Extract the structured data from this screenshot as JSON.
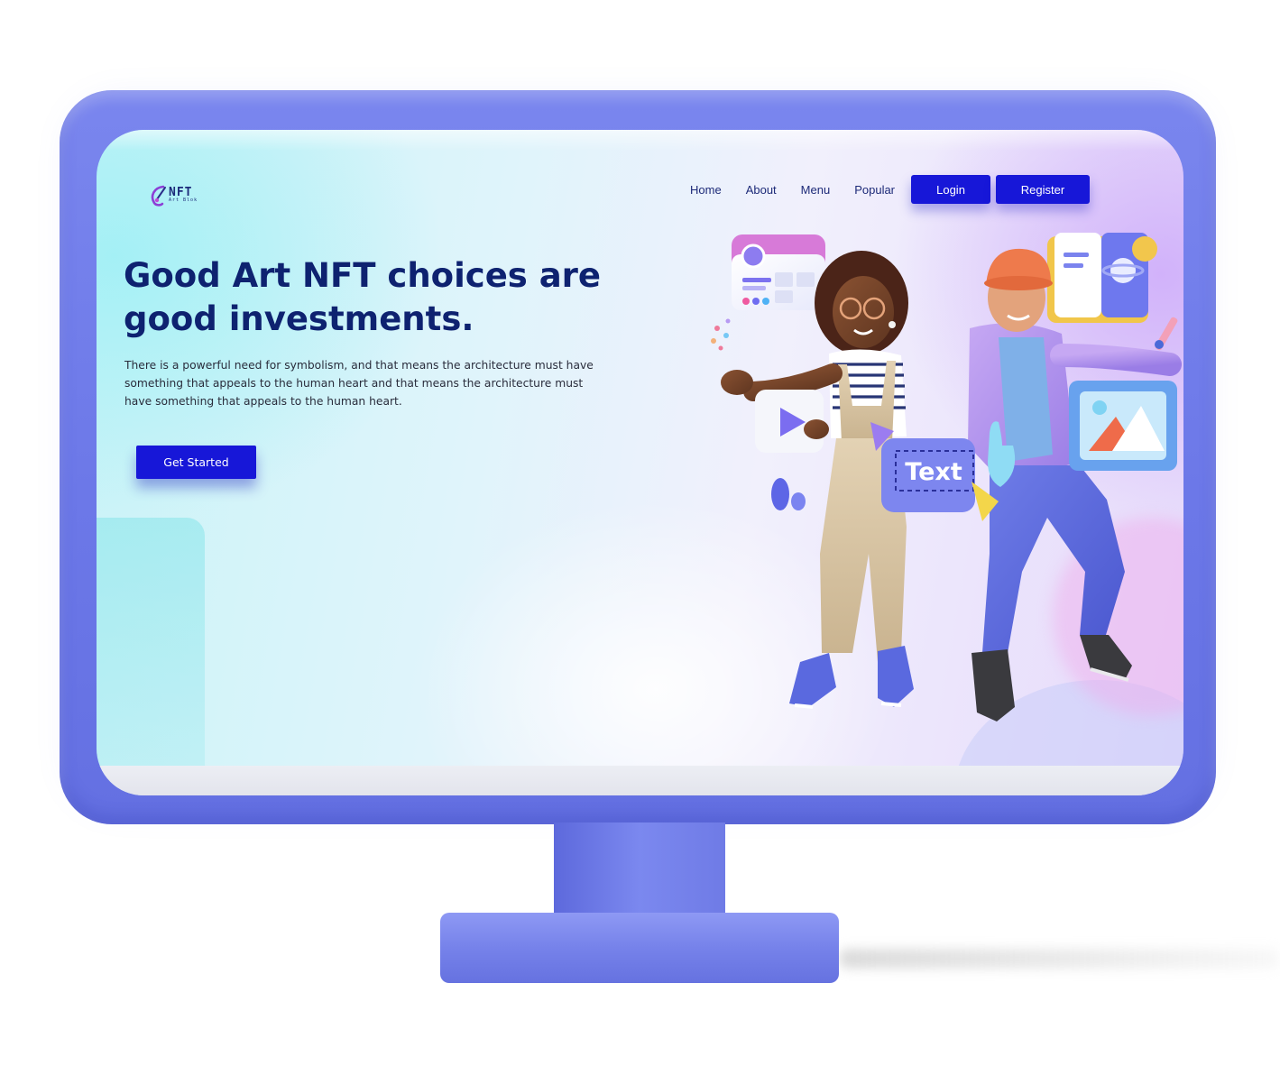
{
  "logo": {
    "title": "NFT",
    "subtitle": "Art Blok"
  },
  "nav": {
    "links": [
      "Home",
      "About",
      "Menu",
      "Popular"
    ],
    "login": "Login",
    "register": "Register"
  },
  "hero": {
    "title_line1": "Good Art NFT choices are",
    "title_line2": "good investments.",
    "paragraph": "There is a powerful need for symbolism, and that means the architecture must have something that appeals to the human heart and that means the architecture must have something that appeals to the human heart.",
    "cta": "Get Started"
  },
  "illustration": {
    "tag_text": "Text"
  },
  "colors": {
    "accent": "#1717d8",
    "heading": "#0e2270",
    "monitor": "#6c78e8"
  }
}
